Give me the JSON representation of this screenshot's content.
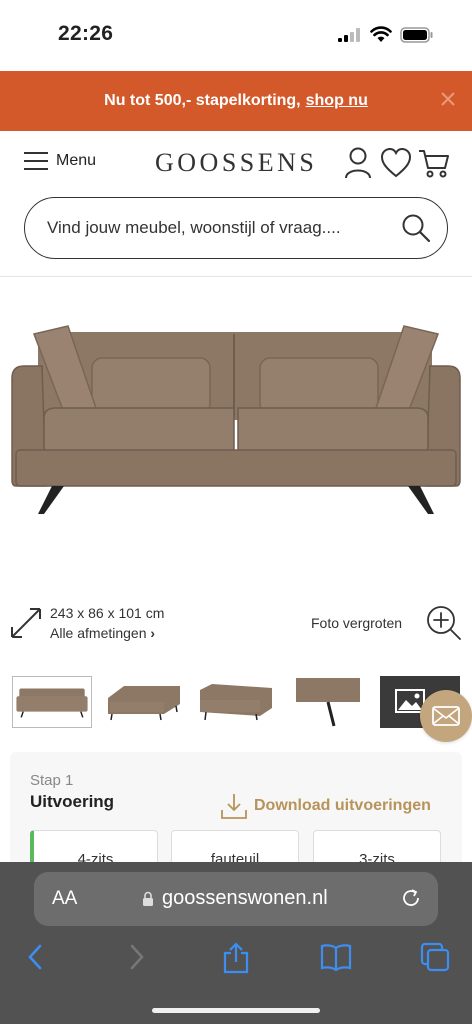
{
  "status_bar": {
    "time": "22:26"
  },
  "promo": {
    "text": "Nu tot 500,- stapelkorting,",
    "link": "shop nu"
  },
  "header": {
    "menu_label": "Menu",
    "logo": "GOOSSENS"
  },
  "search": {
    "placeholder": "Vind jouw meubel, woonstijl of vraag...."
  },
  "product": {
    "dimensions": "243 x 86 x 101 cm",
    "all_dimensions": "Alle afmetingen",
    "zoom_label": "Foto vergroten"
  },
  "configurator": {
    "step": "Stap 1",
    "title": "Uitvoering",
    "download": "Download uitvoeringen",
    "options": [
      "4-zits",
      "fauteuil",
      "3-zits"
    ]
  },
  "browser": {
    "aa": "AA",
    "url": "goossenswonen.nl"
  },
  "colors": {
    "promo": "#d3592b",
    "accent": "#b8935a",
    "selected": "#5cb85c",
    "sofa": "#8e7a69"
  }
}
